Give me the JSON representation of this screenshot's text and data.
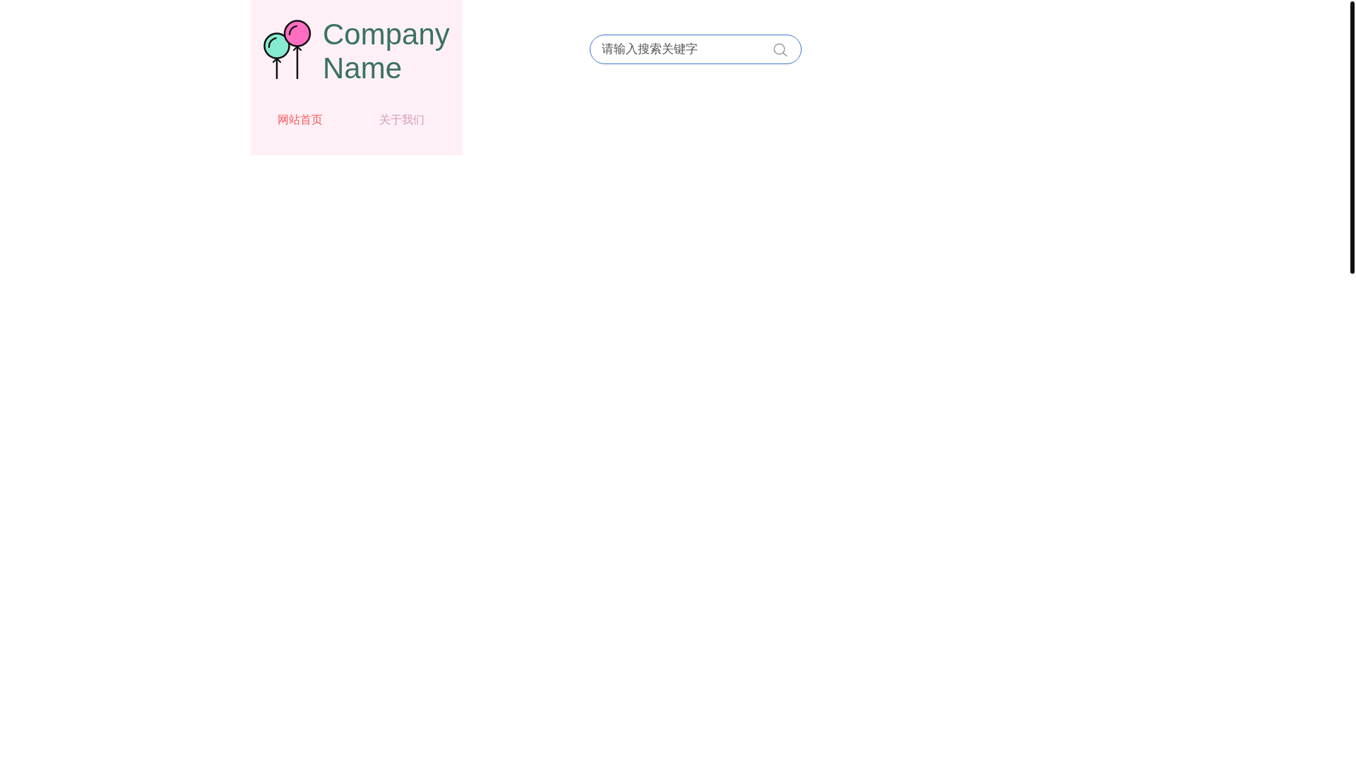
{
  "header": {
    "company_name": "Company Name",
    "nav": [
      {
        "label": "网站首页",
        "selected": true
      },
      {
        "label": "关于我们",
        "selected": false
      }
    ]
  },
  "search": {
    "placeholder": "请输入搜索关键字"
  }
}
